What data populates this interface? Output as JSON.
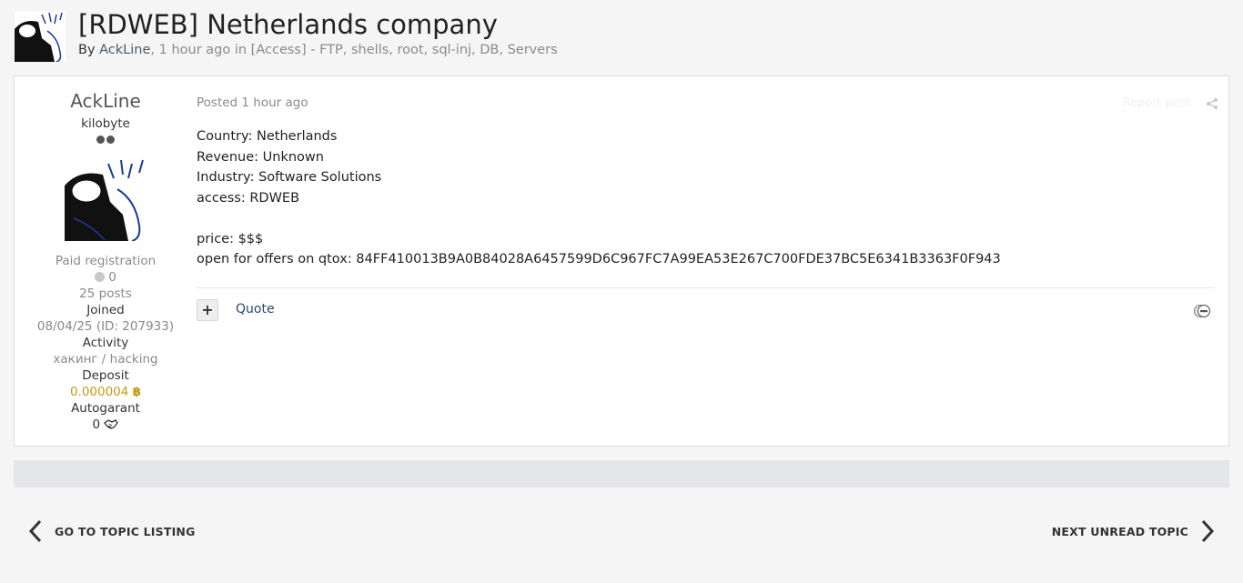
{
  "topic": {
    "title": "[RDWEB] Netherlands company",
    "meta_by": "By ",
    "author": "AckLine",
    "meta_time": ", 1 hour ago in [Access] - FTP, shells, root, sql-inj, DB, Servers"
  },
  "author_panel": {
    "name": "AckLine",
    "rank": "kilobyte",
    "registration": "Paid registration",
    "reputation": "0",
    "posts": "25 posts",
    "joined_label": "Joined",
    "joined_value": "08/04/25 (ID: 207933)",
    "activity_label": "Activity",
    "activity_value": "хакинг / hacking",
    "deposit_label": "Deposit",
    "deposit_value": "0.000004",
    "autogarant_label": "Autogarant",
    "autogarant_value": "0"
  },
  "post": {
    "posted": "Posted 1 hour ago",
    "report": "Report post",
    "lines": [
      "Country: Netherlands",
      "Revenue: Unknown",
      "Industry: Software Solutions",
      "access: RDWEB",
      "",
      "price: $$$",
      "open for offers on qtox: 84FF410013B9A0B84028A6457599D6C967FC7A99EA53E267C700FDE37BC5E6341B3363F0F943"
    ],
    "plus": "+",
    "quote": "Quote"
  },
  "nav": {
    "prev": "GO TO TOPIC LISTING",
    "next": "NEXT UNREAD TOPIC"
  },
  "icons": {
    "share": "share-icon",
    "bitcoin": "bitcoin-icon",
    "handshake": "handshake-icon",
    "reaction": "reaction-icon",
    "prev": "chevron-left-icon",
    "next": "chevron-right-icon"
  },
  "colors": {
    "deposit": "#c29a12",
    "link": "#2f4a66"
  }
}
